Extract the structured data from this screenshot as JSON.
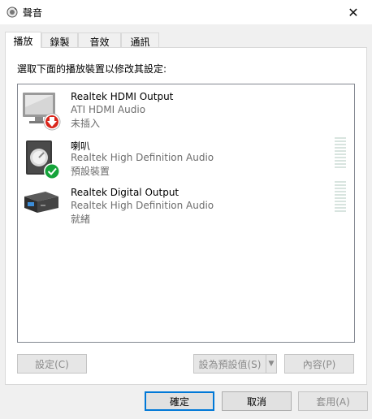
{
  "window": {
    "title": "聲音",
    "close_glyph": "✕"
  },
  "tabs": [
    {
      "label": "播放",
      "active": true
    },
    {
      "label": "錄製",
      "active": false
    },
    {
      "label": "音效",
      "active": false
    },
    {
      "label": "通訊",
      "active": false
    }
  ],
  "playback": {
    "instruction": "選取下面的播放裝置以修改其設定:",
    "devices": [
      {
        "name": "Realtek HDMI Output",
        "driver": "ATI HDMI Audio",
        "status": "未插入",
        "icon": "monitor-icon",
        "badge": "unplugged-badge-icon"
      },
      {
        "name": "喇叭",
        "driver": "Realtek High Definition Audio",
        "status": "預設裝置",
        "icon": "speaker-icon",
        "badge": "default-check-badge-icon"
      },
      {
        "name": "Realtek Digital Output",
        "driver": "Realtek High Definition Audio",
        "status": "就緒",
        "icon": "digital-output-icon",
        "badge": ""
      }
    ],
    "buttons": {
      "configure": "設定(C)",
      "set_default": "設為預設值(S)",
      "set_default_arrow": "▼",
      "properties": "內容(P)"
    }
  },
  "footer": {
    "ok": "確定",
    "cancel": "取消",
    "apply": "套用(A)"
  },
  "colors": {
    "accent": "#0078d7",
    "badge_red": "#d9261c",
    "badge_green": "#15a33a",
    "meter": "#d8e4df"
  }
}
